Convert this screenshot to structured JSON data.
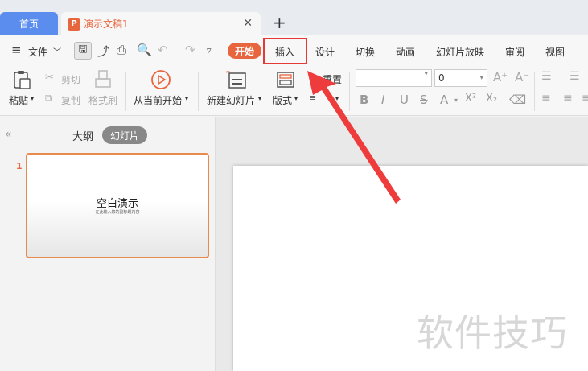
{
  "tabs": {
    "home_label": "首页",
    "document_title": "演示文稿1",
    "doc_icon": "P"
  },
  "menu": {
    "file_label": "文件",
    "items": [
      "开始",
      "插入",
      "设计",
      "切换",
      "动画",
      "幻灯片放映",
      "审阅",
      "视图"
    ],
    "highlighted": "插入"
  },
  "ribbon": {
    "paste": "粘贴",
    "cut": "剪切",
    "copy": "复制",
    "format_painter": "格式刷",
    "play_from_current": "从当前开始",
    "new_slide": "新建幻灯片",
    "layout": "版式",
    "reset": "重置",
    "font_size": "0",
    "format_buttons": [
      "B",
      "I",
      "U",
      "S",
      "A",
      "X²",
      "X₂"
    ]
  },
  "left_panel": {
    "outline_tab": "大纲",
    "slides_tab": "幻灯片",
    "slide_number": "1",
    "thumb_title": "空白演示",
    "thumb_subtitle": "在此输入您的副标题内容"
  },
  "watermark": "软件技巧",
  "colors": {
    "accent": "#e8663e",
    "home_tab": "#5b8def",
    "highlight": "#e53935"
  }
}
